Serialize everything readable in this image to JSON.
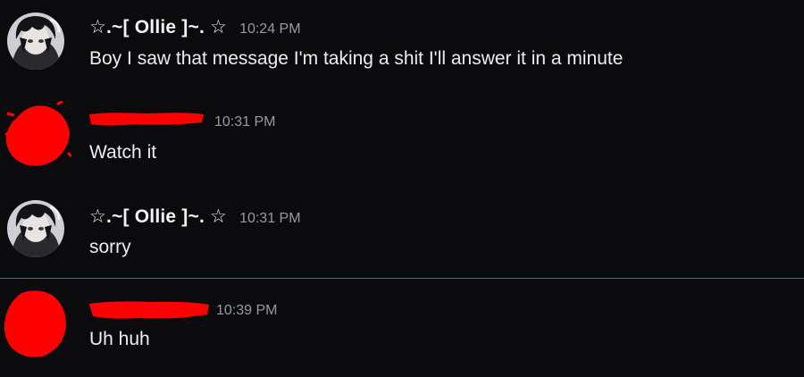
{
  "messages": [
    {
      "author": "☆.~[ Ollie ]~. ☆",
      "time": "10:24 PM",
      "text": "Boy I saw that message I'm taking a shit I'll answer it in a minute",
      "author_redacted": false,
      "avatar": "anime-avatar"
    },
    {
      "author": "",
      "time": "10:31 PM",
      "text": "Watch it",
      "author_redacted": true,
      "avatar": "red-scribble-avatar"
    },
    {
      "author": "☆.~[ Ollie ]~. ☆",
      "time": "10:31 PM",
      "text": "sorry",
      "author_redacted": false,
      "avatar": "anime-avatar"
    },
    {
      "author": "",
      "time": "10:39 PM",
      "text": "Uh huh",
      "author_redacted": true,
      "avatar": "red-scribble-avatar"
    }
  ],
  "colors": {
    "background": "#0b0b0d",
    "timestamp": "#949ba4",
    "redaction": "#ff0000",
    "new_divider": "#c23a3a"
  }
}
